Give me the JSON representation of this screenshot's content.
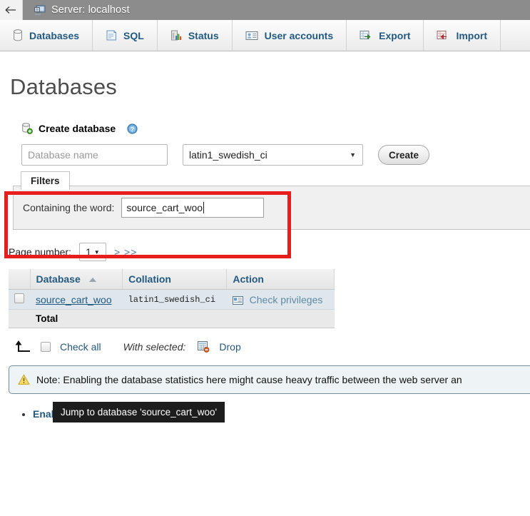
{
  "titlebar": {
    "back_icon": "back-arrow-icon",
    "server_icon": "server-monitor-icon",
    "title": "Server: localhost"
  },
  "nav_tabs": [
    {
      "label": "Databases",
      "icon": "database-icon"
    },
    {
      "label": "SQL",
      "icon": "sql-scroll-icon"
    },
    {
      "label": "Status",
      "icon": "status-chart-icon"
    },
    {
      "label": "User accounts",
      "icon": "user-card-icon"
    },
    {
      "label": "Export",
      "icon": "export-icon"
    },
    {
      "label": "Import",
      "icon": "import-icon"
    }
  ],
  "page": {
    "title": "Databases"
  },
  "create_database": {
    "heading": "Create database",
    "db_icon": "database-add-icon",
    "help_icon": "help-question-icon",
    "name_placeholder": "Database name",
    "name_value": "",
    "collation_value": "latin1_swedish_ci",
    "collation_caret": "▼",
    "create_button": "Create"
  },
  "filters": {
    "legend": "Filters",
    "containing_label": "Containing the word:",
    "containing_value": "source_cart_woo",
    "highlight_color": "#e81d1d"
  },
  "pager": {
    "label": "Page number:",
    "selected_page": "1",
    "caret": "▼",
    "next_links": "> >>"
  },
  "db_table": {
    "columns": [
      "",
      "Database",
      "Collation",
      "Action"
    ],
    "sort_column": "Database",
    "sort_direction": "asc",
    "rows": [
      {
        "checked": false,
        "name": "source_cart_woo",
        "collation": "latin1_swedish_ci",
        "action_icon": "privileges-icon",
        "action_label": "Check privileges"
      }
    ],
    "total_label": "Total",
    "tooltip": "Jump to database 'source_cart_woo'"
  },
  "table_footer": {
    "submit_arrow_icon": "submit-arrow-up-icon",
    "check_all_label": "Check all",
    "with_selected_label": "With selected:",
    "drop_icon": "drop-table-icon",
    "drop_label": "Drop"
  },
  "note": {
    "icon": "warning-triangle-icon",
    "text": "Note: Enabling the database statistics here might cause heavy traffic between the web server an"
  },
  "links": {
    "enable_statistics": "Enable statistics"
  }
}
